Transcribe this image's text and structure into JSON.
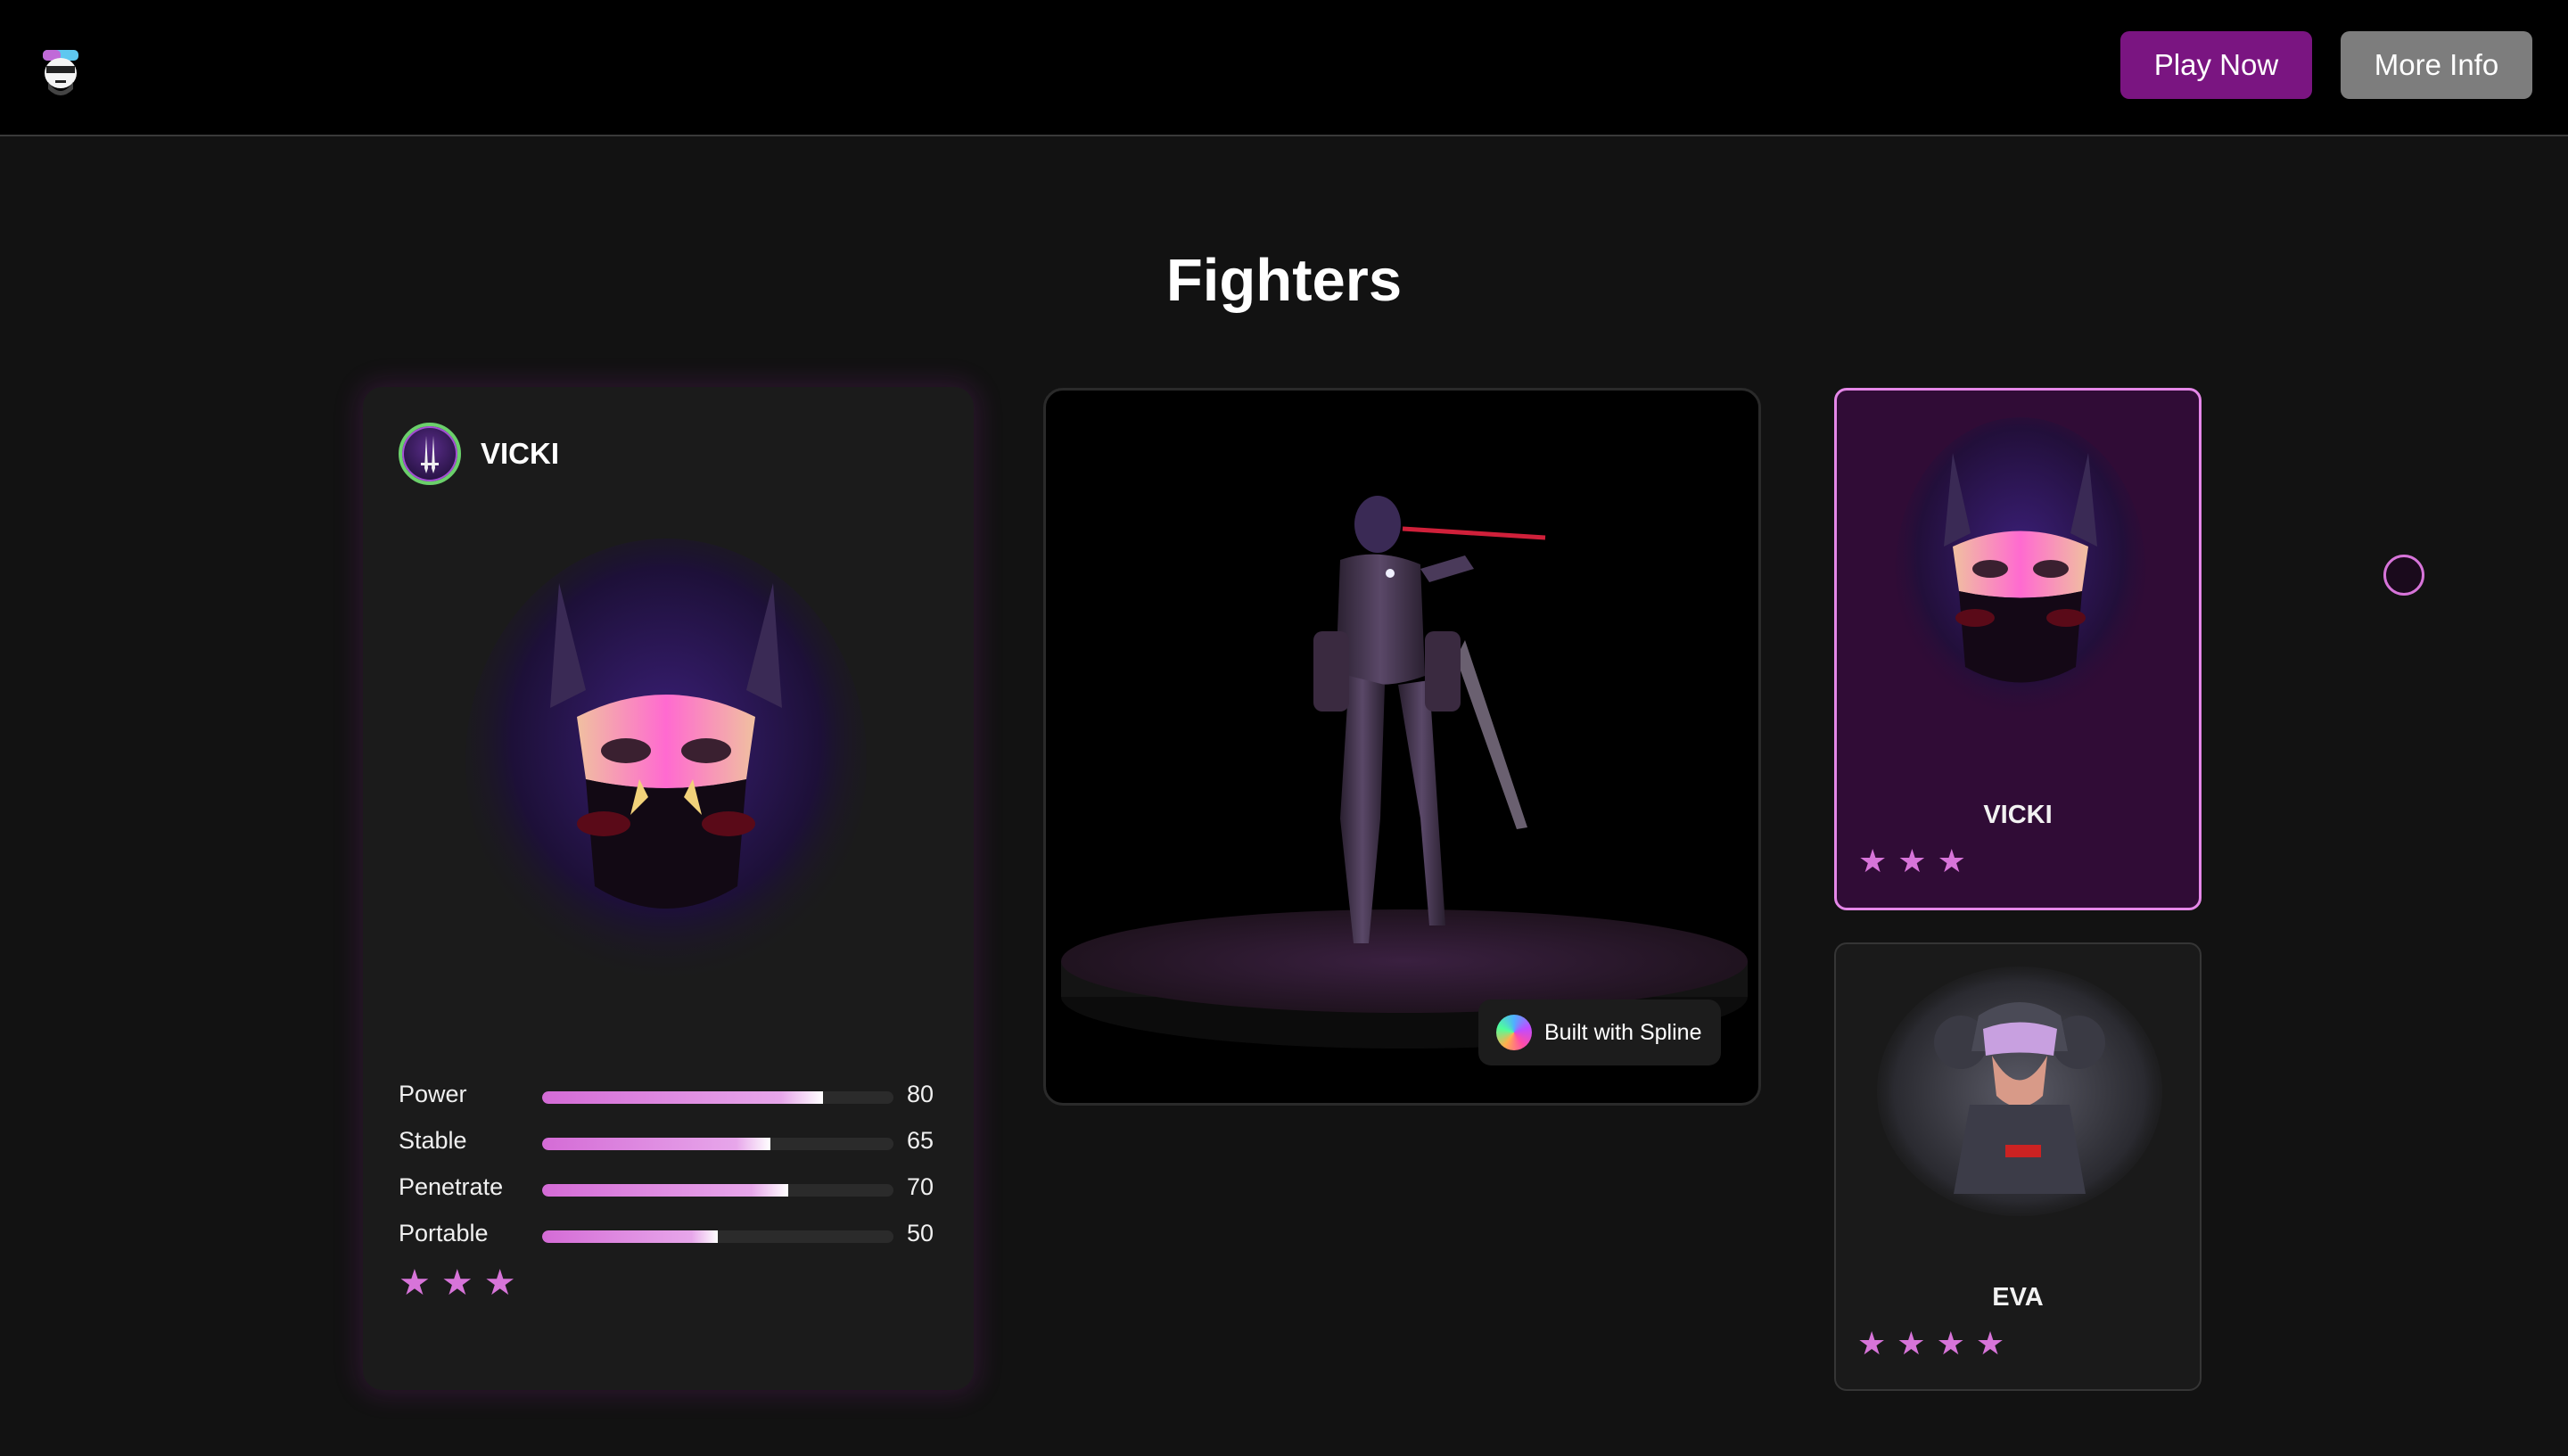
{
  "header": {
    "logo_icon": "hacker-mask-icon",
    "play_label": "Play Now",
    "info_label": "More Info",
    "play_color": "#7a1581",
    "info_color": "#7d7d7d"
  },
  "page": {
    "title": "Fighters"
  },
  "detail": {
    "name": "VICKI",
    "emblem_icon": "sword-emblem-icon",
    "stats": [
      {
        "label": "Power",
        "value": 80
      },
      {
        "label": "Stable",
        "value": 65
      },
      {
        "label": "Penetrate",
        "value": 70
      },
      {
        "label": "Portable",
        "value": 50
      }
    ],
    "stars": 3
  },
  "viewer": {
    "badge_label": "Built with Spline"
  },
  "fighters": [
    {
      "name": "VICKI",
      "stars": 3,
      "selected": true
    },
    {
      "name": "EVA",
      "stars": 4,
      "selected": false
    }
  ],
  "accent_color": "#d774d9"
}
